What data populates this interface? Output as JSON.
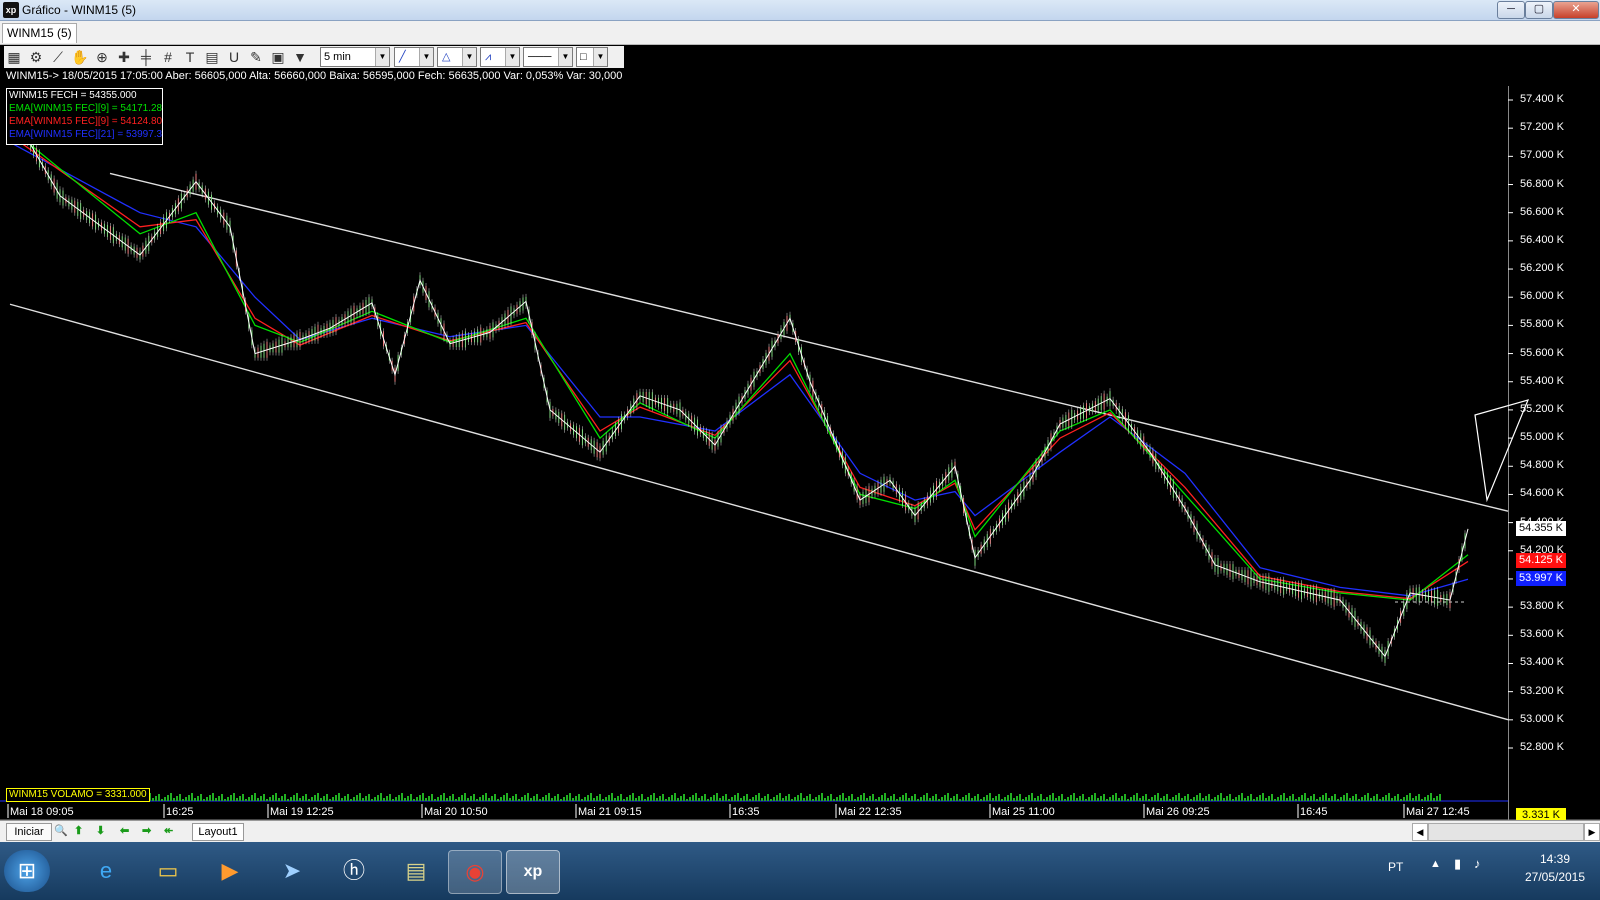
{
  "window": {
    "title": "Gráfico - WINM15 (5)",
    "app_icon": "xp",
    "controls": [
      "─",
      "▢",
      "✕"
    ]
  },
  "tab": {
    "label": "WINM15 (5)"
  },
  "toolbar": {
    "interval": "5 min",
    "icons": [
      "chart-icon",
      "gear-icon",
      "line-tool-icon",
      "hand-icon",
      "zoom-icon",
      "crosshair-icon",
      "cursor-icon",
      "grid-icon",
      "text-icon",
      "calculator-icon",
      "magnet-icon",
      "brush-icon",
      "clipboard-icon",
      "filter-icon"
    ]
  },
  "info_line": "WINM15-> 18/05/2015 17:05:00 Aber: 56605,000 Alta: 56660,000 Baixa: 56595,000 Fech: 56635,000 Var: 0,053% Var: 30,000",
  "legend": [
    {
      "text": "WINM15 FECH = 54355.000",
      "color": "#ffffff"
    },
    {
      "text": "EMA[WINM15 FEC][9] = 54171.286",
      "color": "#00e000"
    },
    {
      "text": "EMA[WINM15 FEC][9] = 54124.807",
      "color": "#ff2020"
    },
    {
      "text": "EMA[WINM15 FEC][21] = 53997.381",
      "color": "#2030ff"
    }
  ],
  "chart_data": {
    "type": "line",
    "series": [
      {
        "name": "WINM15 FECH",
        "color": "#ffffff",
        "points": [
          [
            "Mai 18 09:05",
            57340
          ],
          [
            "Mai 18 10:00",
            56720
          ],
          [
            "Mai 18 12:00",
            56300
          ],
          [
            "Mai 18 16:25",
            56820
          ],
          [
            "Mai 19 09:05",
            56500
          ],
          [
            "Mai 19 10:00",
            55600
          ],
          [
            "Mai 19 12:25",
            55700
          ],
          [
            "Mai 19 14:00",
            55780
          ],
          [
            "Mai 19 16:00",
            55960
          ],
          [
            "Mai 19 17:00",
            55450
          ],
          [
            "Mai 20 09:05",
            56120
          ],
          [
            "Mai 20 10:50",
            55670
          ],
          [
            "Mai 20 14:00",
            55750
          ],
          [
            "Mai 20 16:00",
            55970
          ],
          [
            "Mai 20 17:00",
            55200
          ],
          [
            "Mai 21 09:15",
            54900
          ],
          [
            "Mai 21 12:00",
            55300
          ],
          [
            "Mai 21 14:00",
            55200
          ],
          [
            "Mai 21 16:00",
            54950
          ],
          [
            "Mai 21 16:35",
            55850
          ],
          [
            "Mai 22 09:05",
            55400
          ],
          [
            "Mai 22 11:00",
            54560
          ],
          [
            "Mai 22 12:35",
            54700
          ],
          [
            "Mai 22 14:00",
            54450
          ],
          [
            "Mai 22 16:00",
            54800
          ],
          [
            "Mai 22 17:00",
            54150
          ],
          [
            "Mai 25 09:05",
            54700
          ],
          [
            "Mai 25 11:00",
            55100
          ],
          [
            "Mai 25 14:00",
            55280
          ],
          [
            "Mai 25 17:00",
            54900
          ],
          [
            "Mai 26 09:05",
            54500
          ],
          [
            "Mai 26 09:25",
            54100
          ],
          [
            "Mai 26 12:00",
            53980
          ],
          [
            "Mai 26 16:45",
            53850
          ],
          [
            "Mai 26 17:30",
            53450
          ],
          [
            "Mai 27 09:05",
            53900
          ],
          [
            "Mai 27 11:00",
            53850
          ],
          [
            "Mai 27 12:45",
            54355
          ]
        ]
      },
      {
        "name": "EMA[WINM15 FEC][9]",
        "color": "#00e000",
        "points": [
          [
            "Mai 18 09:05",
            57200
          ],
          [
            "Mai 18 12:00",
            56450
          ],
          [
            "Mai 18 16:25",
            56600
          ],
          [
            "Mai 19 10:00",
            55800
          ],
          [
            "Mai 19 12:25",
            55680
          ],
          [
            "Mai 19 16:00",
            55900
          ],
          [
            "Mai 20 10:50",
            55680
          ],
          [
            "Mai 20 16:00",
            55850
          ],
          [
            "Mai 21 09:15",
            55000
          ],
          [
            "Mai 21 12:00",
            55250
          ],
          [
            "Mai 21 16:00",
            55000
          ],
          [
            "Mai 21 16:35",
            55600
          ],
          [
            "Mai 22 11:00",
            54600
          ],
          [
            "Mai 22 14:00",
            54500
          ],
          [
            "Mai 22 16:00",
            54700
          ],
          [
            "Mai 22 17:00",
            54300
          ],
          [
            "Mai 25 11:00",
            55050
          ],
          [
            "Mai 25 14:00",
            55200
          ],
          [
            "Mai 26 09:05",
            54600
          ],
          [
            "Mai 26 12:00",
            54000
          ],
          [
            "Mai 26 16:45",
            53900
          ],
          [
            "Mai 27 09:05",
            53850
          ],
          [
            "Mai 27 12:45",
            54171.286
          ]
        ]
      },
      {
        "name": "EMA[WINM15 FEC][9]",
        "color": "#ff2020",
        "points": [
          [
            "Mai 18 09:05",
            57150
          ],
          [
            "Mai 18 12:00",
            56500
          ],
          [
            "Mai 18 16:25",
            56550
          ],
          [
            "Mai 19 10:00",
            55850
          ],
          [
            "Mai 19 12:25",
            55660
          ],
          [
            "Mai 19 16:00",
            55870
          ],
          [
            "Mai 20 10:50",
            55690
          ],
          [
            "Mai 20 16:00",
            55820
          ],
          [
            "Mai 21 09:15",
            55050
          ],
          [
            "Mai 21 12:00",
            55220
          ],
          [
            "Mai 21 16:00",
            55020
          ],
          [
            "Mai 21 16:35",
            55550
          ],
          [
            "Mai 22 11:00",
            54650
          ],
          [
            "Mai 22 14:00",
            54520
          ],
          [
            "Mai 22 16:00",
            54680
          ],
          [
            "Mai 22 17:00",
            54350
          ],
          [
            "Mai 25 11:00",
            55000
          ],
          [
            "Mai 25 14:00",
            55180
          ],
          [
            "Mai 26 09:05",
            54650
          ],
          [
            "Mai 26 12:00",
            54020
          ],
          [
            "Mai 26 16:45",
            53910
          ],
          [
            "Mai 27 09:05",
            53860
          ],
          [
            "Mai 27 12:45",
            54124.807
          ]
        ]
      },
      {
        "name": "EMA[WINM15 FEC][21]",
        "color": "#2030ff",
        "points": [
          [
            "Mai 18 09:05",
            57100
          ],
          [
            "Mai 18 12:00",
            56600
          ],
          [
            "Mai 18 16:25",
            56500
          ],
          [
            "Mai 19 10:00",
            56000
          ],
          [
            "Mai 19 12:25",
            55700
          ],
          [
            "Mai 19 16:00",
            55850
          ],
          [
            "Mai 20 10:50",
            55720
          ],
          [
            "Mai 20 16:00",
            55800
          ],
          [
            "Mai 21 09:15",
            55150
          ],
          [
            "Mai 21 12:00",
            55150
          ],
          [
            "Mai 21 16:00",
            55050
          ],
          [
            "Mai 21 16:35",
            55450
          ],
          [
            "Mai 22 11:00",
            54750
          ],
          [
            "Mai 22 14:00",
            54560
          ],
          [
            "Mai 22 16:00",
            54620
          ],
          [
            "Mai 22 17:00",
            54450
          ],
          [
            "Mai 25 11:00",
            54900
          ],
          [
            "Mai 25 14:00",
            55150
          ],
          [
            "Mai 26 09:05",
            54750
          ],
          [
            "Mai 26 12:00",
            54080
          ],
          [
            "Mai 26 16:45",
            53940
          ],
          [
            "Mai 27 09:05",
            53880
          ],
          [
            "Mai 27 12:45",
            53997.381
          ]
        ]
      }
    ],
    "trendlines": [
      {
        "name": "channel-upper",
        "from": [
          "Mai 18 09:05",
          57050
        ],
        "to": [
          "Mai 27 12:45",
          54550
        ]
      },
      {
        "name": "channel-lower",
        "from": [
          "Mai 18 09:05",
          55950
        ],
        "to": [
          "Mai 27 12:45",
          53080
        ]
      }
    ],
    "y_ticks": [
      "57.400 K",
      "57.200 K",
      "57.000 K",
      "56.800 K",
      "56.600 K",
      "56.400 K",
      "56.200 K",
      "56.000 K",
      "55.800 K",
      "55.600 K",
      "55.400 K",
      "55.200 K",
      "55.000 K",
      "54.800 K",
      "54.600 K",
      "54.400 K",
      "54.200 K",
      "54.000 K",
      "53.800 K",
      "53.600 K",
      "53.400 K",
      "53.200 K",
      "53.000 K",
      "52.800 K"
    ],
    "ylim": [
      52700,
      57500
    ],
    "x_ticks": [
      "Mai 18 09:05",
      "16:25",
      "Mai 19 12:25",
      "Mai 20 10:50",
      "Mai 21 09:15",
      "16:35",
      "Mai 22 12:35",
      "Mai 25 11:00",
      "Mai 26 09:25",
      "16:45",
      "Mai 27 12:45"
    ],
    "badges": [
      {
        "text": "54.355 K",
        "bg": "#ffffff",
        "fg": "#000000",
        "value": 54355
      },
      {
        "text": "54.125 K",
        "bg": "#ff1010",
        "fg": "#ffffff",
        "value": 54125
      },
      {
        "text": "53.997 K",
        "bg": "#1020ff",
        "fg": "#ffffff",
        "value": 53997
      }
    ]
  },
  "volume": {
    "label": "WINM15 VOLAMO = 3331.000",
    "badge": "3.331 K"
  },
  "bottom_bar": {
    "start_label": "Iniciar",
    "layout_tab": "Layout1"
  },
  "taskbar": {
    "apps": [
      "windows-start-icon",
      "internet-explorer-icon",
      "file-explorer-icon",
      "media-player-icon",
      "transfer-icon",
      "hp-icon",
      "bag-icon",
      "chrome-icon",
      "xp-app-icon"
    ],
    "language": "PT",
    "time": "14:39",
    "date": "27/05/2015"
  }
}
